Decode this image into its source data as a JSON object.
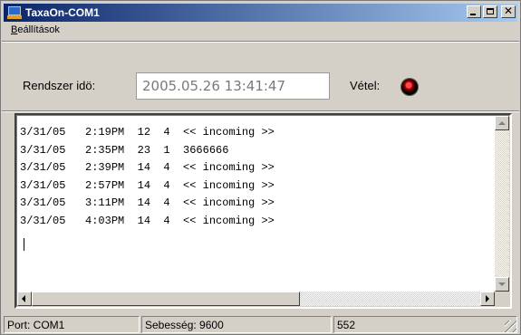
{
  "window": {
    "title": "TaxaOn-COM1",
    "icon": "terminal-app-icon",
    "buttons": {
      "minimize": "minimize-icon",
      "maximize": "maximize-icon",
      "close": "close-icon"
    }
  },
  "menu": {
    "items": [
      {
        "label_first": "B",
        "label_rest": "eállítások"
      }
    ]
  },
  "header": {
    "system_time_label": "Rendszer idö:",
    "system_time_value": "2005.05.26 13:41:47",
    "reception_label": "Vétel:",
    "reception_indicator": "led-indicator-icon",
    "reception_color": "#cc0000"
  },
  "log": {
    "lines": [
      "3/31/05   2:19PM  12  4  << incoming >>",
      "3/31/05   2:35PM  23  1  3666666",
      "3/31/05   2:39PM  14  4  << incoming >>",
      "3/31/05   2:57PM  14  4  << incoming >>",
      "3/31/05   3:11PM  14  4  << incoming >>",
      "3/31/05   4:03PM  14  4  << incoming >>"
    ]
  },
  "status": {
    "port": "Port: COM1",
    "speed": "Sebesség: 9600",
    "count": "552"
  },
  "colors": {
    "titlebar_start": "#0a246a",
    "titlebar_end": "#a6caf0",
    "face": "#d4d0c8"
  }
}
